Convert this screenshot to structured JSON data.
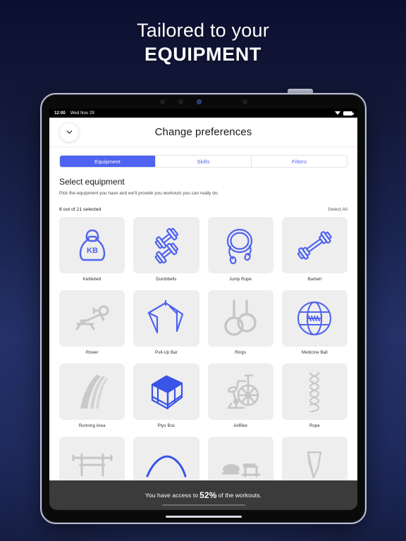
{
  "headline": {
    "line1": "Tailored to your",
    "line2": "EQUIPMENT"
  },
  "device": {
    "status_bar": {
      "time": "12:00",
      "date": "Wed Nov 29",
      "wifi_icon": "wifi-icon",
      "battery_icon": "battery-icon"
    }
  },
  "nav": {
    "title": "Change preferences",
    "back_icon": "chevron-down-icon"
  },
  "tabs": [
    {
      "label": "Equipment",
      "active": true
    },
    {
      "label": "Skills",
      "active": false
    },
    {
      "label": "Filters",
      "active": false
    }
  ],
  "section": {
    "title": "Select equipment",
    "subtitle": "Pick the equipment you have and we'll provide you workouts you can really do."
  },
  "counter": {
    "selected_text": "8 out of 21 selected",
    "selected_count": 8,
    "total_count": 21,
    "select_all_label": "Select All"
  },
  "colors": {
    "accent": "#4f63f0",
    "inactive_icon": "#c6c6c6",
    "card_bg": "#eeeeee",
    "bottom_bar": "#3b3b3b"
  },
  "equipment": [
    {
      "name": "Kettlebell",
      "icon": "kettlebell-icon",
      "selected": true
    },
    {
      "name": "Dumbbells",
      "icon": "dumbbells-icon",
      "selected": true
    },
    {
      "name": "Jump Rope",
      "icon": "jump-rope-icon",
      "selected": true
    },
    {
      "name": "Barbell",
      "icon": "barbell-icon",
      "selected": true
    },
    {
      "name": "Rower",
      "icon": "rower-icon",
      "selected": false
    },
    {
      "name": "Pull-Up Bar",
      "icon": "pull-up-bar-icon",
      "selected": true
    },
    {
      "name": "Rings",
      "icon": "rings-icon",
      "selected": false
    },
    {
      "name": "Medicine Ball",
      "icon": "medicine-ball-icon",
      "selected": true
    },
    {
      "name": "Running Area",
      "icon": "running-area-icon",
      "selected": false
    },
    {
      "name": "Plyo Box",
      "icon": "plyo-box-icon",
      "selected": true
    },
    {
      "name": "AirBike",
      "icon": "airbike-icon",
      "selected": false
    },
    {
      "name": "Rope",
      "icon": "rope-icon",
      "selected": false
    },
    {
      "name": "",
      "icon": "bench-rack-icon",
      "selected": false
    },
    {
      "name": "",
      "icon": "arc-trainer-icon",
      "selected": true
    },
    {
      "name": "",
      "icon": "sled-icon",
      "selected": false
    },
    {
      "name": "",
      "icon": "sandbag-icon",
      "selected": false
    }
  ],
  "access_bar": {
    "prefix": "You have access to",
    "percent": "52%",
    "suffix": "of the workouts."
  }
}
